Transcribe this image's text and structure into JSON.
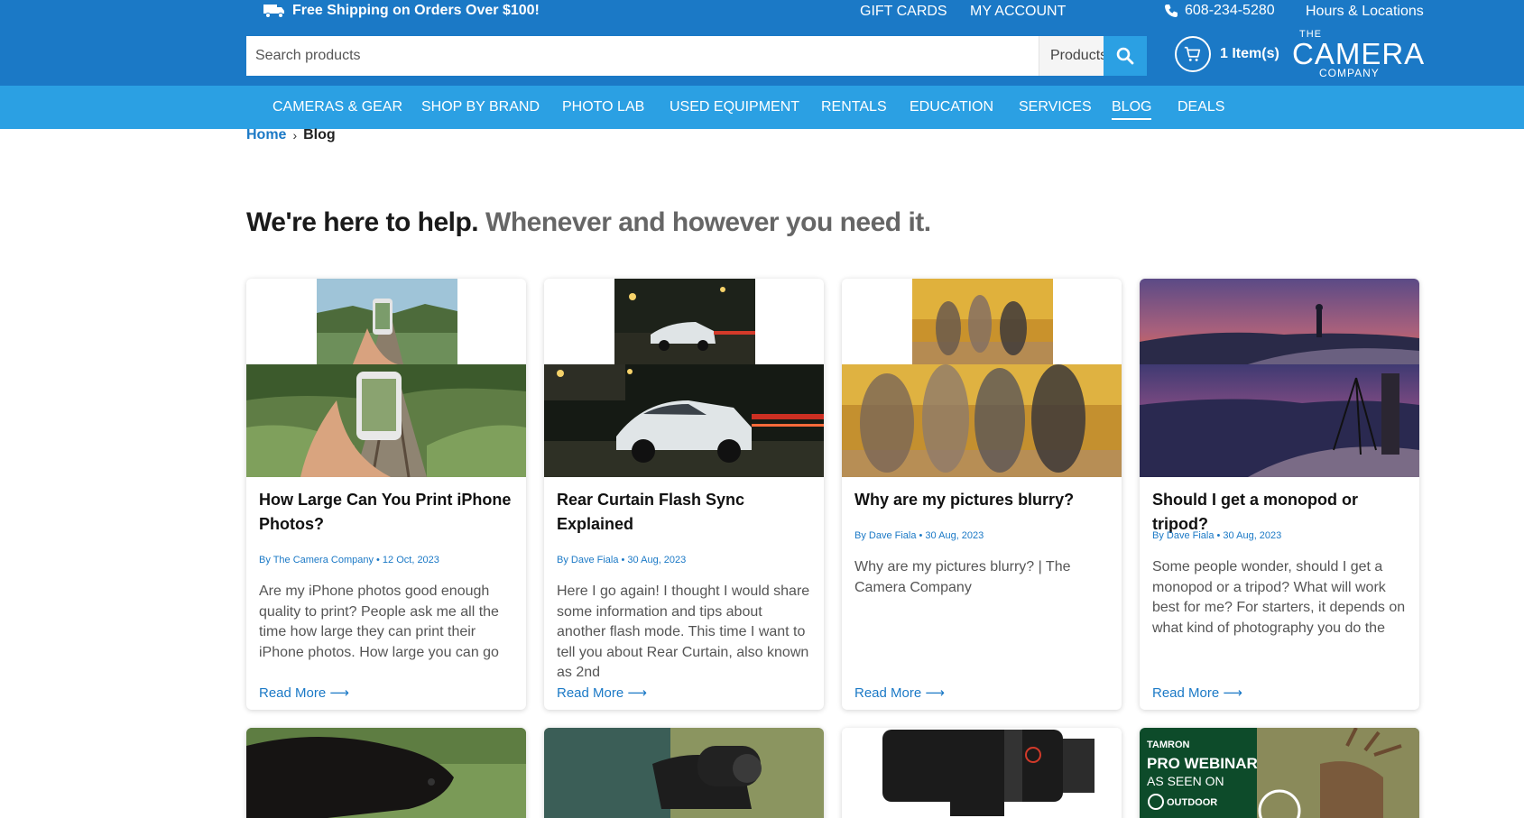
{
  "topbar": {
    "shipping_text": "Free Shipping on Orders Over $100!",
    "gift_cards": "GIFT CARDS",
    "my_account": "MY ACCOUNT",
    "phone": "608-234-5280",
    "hours": "Hours & Locations"
  },
  "header": {
    "search_placeholder": "Search products",
    "category_selected": "Products",
    "cart_text": "1 Item(s)",
    "logo": {
      "the": "THE",
      "camera": "CAMERA",
      "company": "COMPANY"
    }
  },
  "nav": {
    "items": [
      "CAMERAS & GEAR",
      "SHOP BY BRAND",
      "PHOTO LAB",
      "USED EQUIPMENT",
      "RENTALS",
      "EDUCATION",
      "SERVICES",
      "BLOG",
      "DEALS"
    ],
    "active": "BLOG"
  },
  "breadcrumb": {
    "home": "Home",
    "separator": "›",
    "current": "Blog"
  },
  "headline": {
    "dark": "We're here to help.",
    "grey": "Whenever and however you need it."
  },
  "posts": [
    {
      "title": "How Large Can You Print iPhone Photos?",
      "meta": "By The Camera Company • 12 Oct, 2023",
      "excerpt": "Are my iPhone photos good enough quality to print? People ask me all the time how large they can print their iPhone photos. How large you can go",
      "read_more": "Read More ⟶"
    },
    {
      "title": "Rear Curtain Flash Sync Explained",
      "meta": "By Dave Fiala • 30 Aug, 2023",
      "excerpt": "Here I go again! I thought I would share some information and tips about another flash mode. This time I want to tell you about Rear Curtain, also known as 2nd",
      "read_more": "Read More ⟶"
    },
    {
      "title": "Why are my pictures blurry?",
      "meta": "By Dave Fiala • 30 Aug, 2023",
      "excerpt": "Why are my pictures blurry? | The Camera Company",
      "read_more": "Read More ⟶"
    },
    {
      "title": "Should I get a monopod or tripod?",
      "meta": "By Dave Fiala • 30 Aug, 2023",
      "excerpt": "Some people wonder, should I get a monopod or a tripod? What will work best for me? For starters, it depends on what kind of photography you do the",
      "read_more": "Read More ⟶"
    }
  ],
  "webinar_card": {
    "brand": "TAMRON",
    "line1": "PRO WEBINAR",
    "line2": "AS SEEN ON",
    "line3": "OUTDOOR"
  },
  "colors": {
    "primary_blue": "#1b79c6",
    "nav_blue": "#2ba0e3",
    "link_blue": "#1b79c6"
  }
}
